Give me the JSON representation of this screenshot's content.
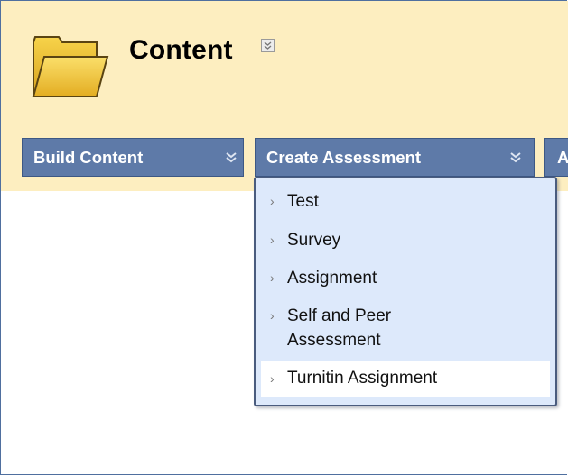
{
  "header": {
    "title": "Content",
    "title_menu_icon": "double-chevron-down-icon",
    "folder_icon": "folder-icon",
    "background": "#fdeec0"
  },
  "action_bar": {
    "build_content_label": "Build Content",
    "create_assessment_label": "Create Assessment",
    "next_label_partial": "A",
    "button_color": "#5e7aa8",
    "chevron_icon": "double-chevron-down-icon"
  },
  "dropdown": {
    "background": "#dde9fb",
    "items": [
      {
        "label": "Test",
        "icon": "chevron-right-icon"
      },
      {
        "label": "Survey",
        "icon": "chevron-right-icon"
      },
      {
        "label": "Assignment",
        "icon": "chevron-right-icon"
      },
      {
        "label_line1": "Self and Peer",
        "label_line2": "Assessment",
        "icon": "chevron-right-icon"
      },
      {
        "label": "Turnitin Assignment",
        "icon": "chevron-right-icon",
        "highlighted": true
      }
    ]
  }
}
